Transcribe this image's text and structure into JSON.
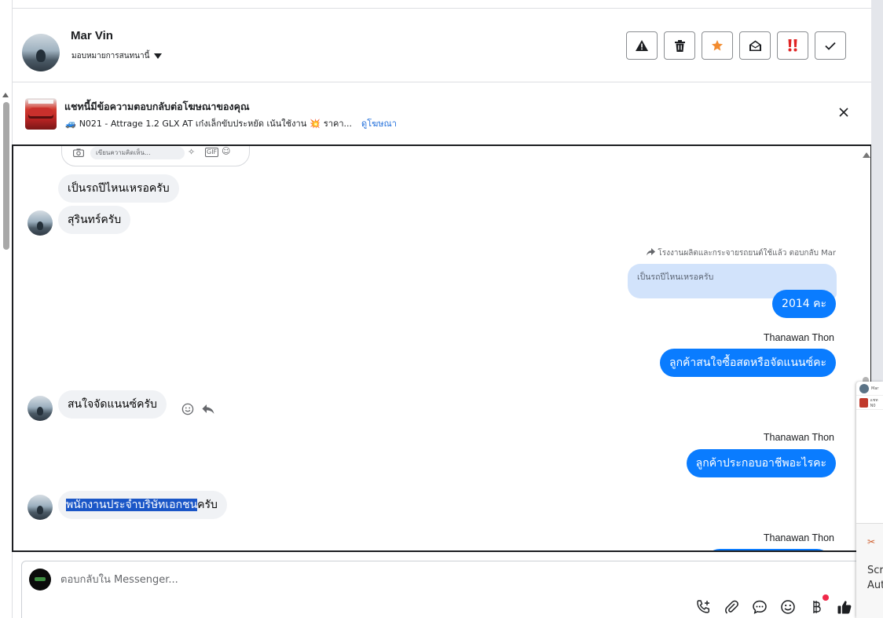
{
  "header": {
    "contact_name": "Mar Vin",
    "assign_label": "มอบหมายการสนทนานี้"
  },
  "actions": [
    {
      "name": "spam-button",
      "icon": "warning-icon",
      "color": "#1c1e21"
    },
    {
      "name": "delete-button",
      "icon": "trash-icon",
      "color": "#1c1e21"
    },
    {
      "name": "star-button",
      "icon": "star-icon",
      "color": "#f28b2f"
    },
    {
      "name": "mark-unread-button",
      "icon": "envelope-open-icon",
      "color": "#1c1e21"
    },
    {
      "name": "priority-button",
      "icon": "double-exclamation-icon",
      "color": "#e02424"
    },
    {
      "name": "done-button",
      "icon": "check-icon",
      "color": "#1c1e21"
    }
  ],
  "ad_banner": {
    "title": "แชทนี้มีข้อความตอบกลับต่อโฆษณาของคุณ",
    "description": "N021 - Attrage 1.2 GLX AT เก๋งเล็กขับประหยัด เน้นใช้งาน",
    "description_tail": "ราคา...",
    "link": "ดูโฆษณา"
  },
  "preview_card": {
    "placeholder": "เขียนความคิดเห็น..."
  },
  "messages": {
    "in_1": "เป็นรถปีไหนเหรอครับ",
    "in_2": "สุรินทร์ครับ",
    "reply_note": "โรงงานผลิตและกระจายรถยนต์ใช้แล้ว ตอบกลับ Mar",
    "quoted": "เป็นรถปีไหนเหรอครับ",
    "out_1": "2014 คะ",
    "sender_1": "Thanawan Thon",
    "out_2": "ลูกค้าสนใจซื้อสดหรือจัดแนนซ์คะ",
    "in_3": "สนใจจัดแนนซ์ครับ",
    "sender_2": "Thanawan Thon",
    "out_3": "ลูกค้าประกอบอาชีพอะไรคะ",
    "in_4_highlighted": "พนักงานประจำบริษัทเอกชน",
    "in_4_rest": "ครับ",
    "sender_3": "Thanawan Thon"
  },
  "composer": {
    "placeholder": "ตอบกลับใน Messenger..."
  },
  "floating_panel": {
    "row_1": "Mar",
    "row_2": "แชท N0",
    "card_text": "Scr Aut"
  },
  "colors": {
    "outgoing_bubble": "#0a7cff",
    "incoming_bubble": "#f0f2f5",
    "quoted_bubble": "#d2e3fb",
    "link": "#216fdb",
    "highlight": "#1a56c7"
  }
}
